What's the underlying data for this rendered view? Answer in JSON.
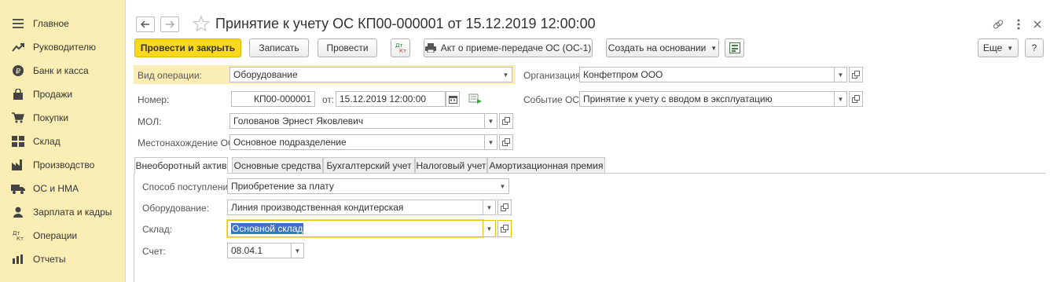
{
  "sidebar": {
    "items": [
      {
        "label": "Главное",
        "icon": "menu-icon"
      },
      {
        "label": "Руководителю",
        "icon": "trend-icon"
      },
      {
        "label": "Банк и касса",
        "icon": "ruble-icon"
      },
      {
        "label": "Продажи",
        "icon": "bag-icon"
      },
      {
        "label": "Покупки",
        "icon": "cart-icon"
      },
      {
        "label": "Склад",
        "icon": "warehouse-icon"
      },
      {
        "label": "Производство",
        "icon": "factory-icon"
      },
      {
        "label": "ОС и НМА",
        "icon": "truck-icon"
      },
      {
        "label": "Зарплата и кадры",
        "icon": "person-icon"
      },
      {
        "label": "Операции",
        "icon": "dt-kt-icon"
      },
      {
        "label": "Отчеты",
        "icon": "bar-chart-icon"
      }
    ]
  },
  "header": {
    "title": "Принятие к учету ОС КП00-000001 от 15.12.2019 12:00:00"
  },
  "toolbar": {
    "post_close": "Провести и закрыть",
    "save": "Записать",
    "post": "Провести",
    "dt_kt": "Дт Кт",
    "print_act": "Акт о приеме-передаче ОС (ОС-1)",
    "create_based": "Создать на основании",
    "more": "Еще",
    "help": "?"
  },
  "form": {
    "operation_label": "Вид операции:",
    "operation_value": "Оборудование",
    "organization_label": "Организация:",
    "organization_value": "Конфетпром ООО",
    "number_label": "Номер:",
    "number_value": "КП00-000001",
    "date_label": "от:",
    "date_value": "15.12.2019 12:00:00",
    "event_label": "Событие ОС:",
    "event_value": "Принятие к учету с вводом в эксплуатацию",
    "mol_label": "МОЛ:",
    "mol_value": "Голованов Эрнест Яковлевич",
    "location_label": "Местонахождение ОС:",
    "location_value": "Основное подразделение"
  },
  "tabs": [
    {
      "label": "Внеоборотный актив",
      "active": true
    },
    {
      "label": "Основные средства",
      "active": false
    },
    {
      "label": "Бухгалтерский учет",
      "active": false
    },
    {
      "label": "Налоговый учет",
      "active": false
    },
    {
      "label": "Амортизационная премия",
      "active": false
    }
  ],
  "tab_content": {
    "receipt_label": "Способ поступления:",
    "receipt_value": "Приобретение за плату",
    "equipment_label": "Оборудование:",
    "equipment_value": "Линия производственная кондитерская",
    "warehouse_label": "Склад:",
    "warehouse_value": "Основной склад",
    "account_label": "Счет:",
    "account_value": "08.04.1"
  },
  "colors": {
    "sidebar_bg": "#fbeeb4",
    "primary_button": "#fbd71e",
    "selection": "#3a74c9"
  }
}
